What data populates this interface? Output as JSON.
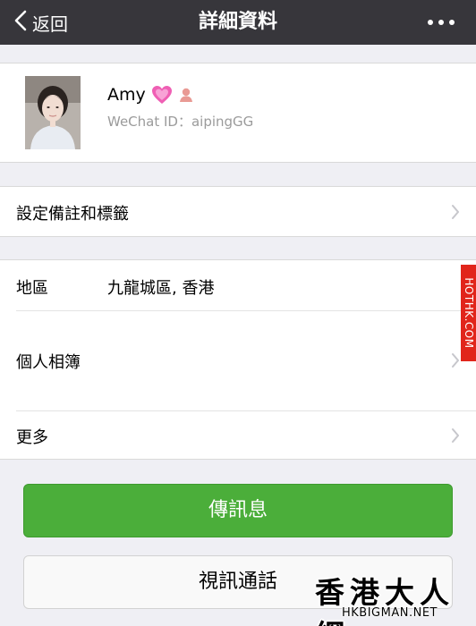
{
  "navbar": {
    "back_label": "返回",
    "title": "詳細資料",
    "more_icon": "more-dots-icon"
  },
  "profile": {
    "name": "Amy",
    "name_emoji_icon": "heart-icon",
    "gender_icon": "female-icon",
    "wechat_id_label": "WeChat ID：",
    "wechat_id": "aipingGG"
  },
  "cells": {
    "remark": {
      "label": "設定備註和標籤"
    },
    "region": {
      "label": "地區",
      "value": "九龍城區, 香港"
    },
    "album": {
      "label": "個人相簿"
    },
    "more": {
      "label": "更多"
    }
  },
  "buttons": {
    "message": "傳訊息",
    "video_call": "視訊通話"
  },
  "watermarks": {
    "side_tag": "HOTHK.COM",
    "brand": "香港大人網",
    "url": "HKBIGMAN.NET"
  },
  "colors": {
    "navbar_bg": "#37363b",
    "primary_green": "#4bae3a",
    "side_tag_red": "#e1251b",
    "secondary_text": "#9b9b9b"
  }
}
